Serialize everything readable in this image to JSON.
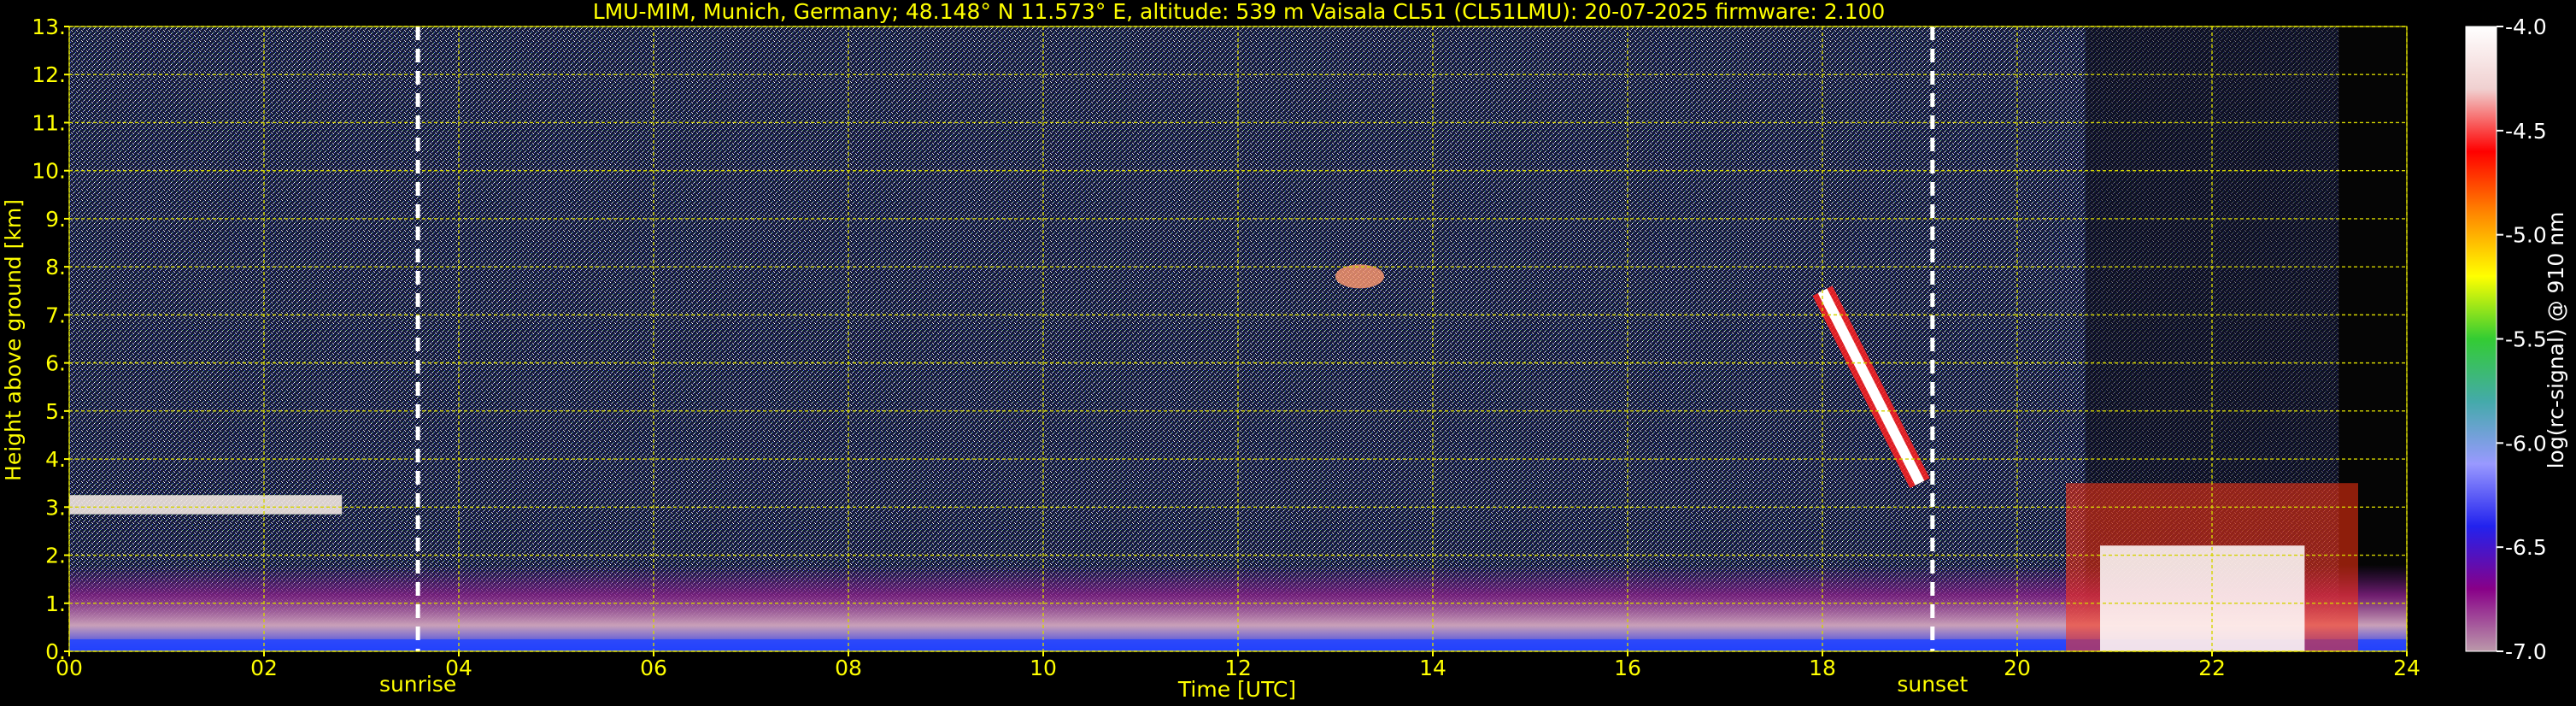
{
  "chart_data": {
    "type": "heatmap",
    "title": "LMU-MIM, Munich, Germany; 48.148° N 11.573° E, altitude: 539 m    Vaisala CL51 (CL51LMU): 20-07-2025    firmware: 2.100",
    "xlabel": "Time [UTC]",
    "ylabel": "Height above ground [km]",
    "xlim": [
      0,
      24
    ],
    "ylim": [
      0,
      13
    ],
    "x_ticks": [
      "00",
      "02",
      "04",
      "06",
      "08",
      "10",
      "12",
      "14",
      "16",
      "18",
      "20",
      "22",
      "24"
    ],
    "y_ticks": [
      "0.",
      "1.",
      "2.",
      "3.",
      "4.",
      "5.",
      "6.",
      "7.",
      "8.",
      "9.",
      "10.",
      "11.",
      "12.",
      "13."
    ],
    "grid": true,
    "colorbar": {
      "label": "log(rc-signal) @ 910 nm",
      "range": [
        -7.0,
        -4.0
      ],
      "ticks": [
        "-4.0",
        "-4.5",
        "-5.0",
        "-5.5",
        "-6.0",
        "-6.5",
        "-7.0"
      ],
      "colors": [
        "#ffffff",
        "#f0d0d0",
        "#ff0000",
        "#ff8800",
        "#ffff00",
        "#33cc33",
        "#44aaaa",
        "#9999ff",
        "#2222ee",
        "#880088",
        "#bb99aa"
      ]
    },
    "annotations": [
      {
        "text": "sunrise",
        "x": 3.58
      },
      {
        "text": "sunset",
        "x": 19.13
      }
    ],
    "features": [
      {
        "name": "mixed layer",
        "time_range": [
          0,
          24
        ],
        "top_km": 0.9
      },
      {
        "name": "cloud layer",
        "time_range": [
          0,
          2.8
        ],
        "height_km": 3.0
      },
      {
        "name": "cirrus",
        "time_range": [
          13,
          13.5
        ],
        "height_km": 7.8
      },
      {
        "name": "descending cloud",
        "time_range": [
          18,
          19
        ],
        "height_km": [
          7.5,
          3.5
        ]
      },
      {
        "name": "low clouds",
        "time_range": [
          20.5,
          23.5
        ],
        "height_km": [
          0,
          3.5
        ]
      }
    ]
  }
}
